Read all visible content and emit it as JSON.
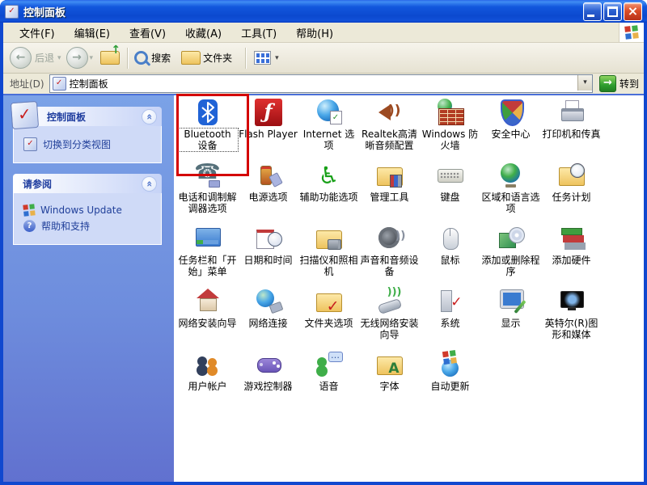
{
  "window": {
    "title": "控制面板"
  },
  "menubar": {
    "items": [
      "文件(F)",
      "编辑(E)",
      "查看(V)",
      "收藏(A)",
      "工具(T)",
      "帮助(H)"
    ]
  },
  "toolbar": {
    "back_label": "后退",
    "search_label": "搜索",
    "folders_label": "文件夹"
  },
  "addressbar": {
    "label": "地址(D)",
    "value": "控制面板",
    "go_label": "转到"
  },
  "sidebar": {
    "panels": [
      {
        "title": "控制面板",
        "items": [
          {
            "label": "切换到分类视图",
            "icon": "switch-category-view-icon"
          }
        ]
      },
      {
        "title": "请参阅",
        "items": [
          {
            "label": "Windows Update",
            "icon": "windows-update-icon"
          },
          {
            "label": "帮助和支持",
            "icon": "help-support-icon"
          }
        ]
      }
    ]
  },
  "grid": {
    "items": [
      {
        "label": "Bluetooth 设备",
        "icon": "bluetooth-devices-icon",
        "highlighted": true,
        "selected": true
      },
      {
        "label": "Flash Player",
        "icon": "flash-player-icon"
      },
      {
        "label": "Internet 选项",
        "icon": "internet-options-icon"
      },
      {
        "label": "Realtek高清晰音频配置",
        "icon": "realtek-audio-icon"
      },
      {
        "label": "Windows 防火墙",
        "icon": "windows-firewall-icon"
      },
      {
        "label": "安全中心",
        "icon": "security-center-icon"
      },
      {
        "label": "打印机和传真",
        "icon": "printers-faxes-icon"
      },
      {
        "label": "电话和调制解调器选项",
        "icon": "phone-modem-options-icon"
      },
      {
        "label": "电源选项",
        "icon": "power-options-icon"
      },
      {
        "label": "辅助功能选项",
        "icon": "accessibility-options-icon"
      },
      {
        "label": "管理工具",
        "icon": "administrative-tools-icon"
      },
      {
        "label": "键盘",
        "icon": "keyboard-icon"
      },
      {
        "label": "区域和语言选项",
        "icon": "regional-language-options-icon"
      },
      {
        "label": "任务计划",
        "icon": "scheduled-tasks-icon"
      },
      {
        "label": "任务栏和「开始」菜单",
        "icon": "taskbar-start-menu-icon"
      },
      {
        "label": "日期和时间",
        "icon": "date-time-icon"
      },
      {
        "label": "扫描仪和照相机",
        "icon": "scanners-cameras-icon"
      },
      {
        "label": "声音和音频设备",
        "icon": "sounds-audio-devices-icon"
      },
      {
        "label": "鼠标",
        "icon": "mouse-icon"
      },
      {
        "label": "添加或删除程序",
        "icon": "add-remove-programs-icon"
      },
      {
        "label": "添加硬件",
        "icon": "add-hardware-icon"
      },
      {
        "label": "网络安装向导",
        "icon": "network-setup-wizard-icon"
      },
      {
        "label": "网络连接",
        "icon": "network-connections-icon"
      },
      {
        "label": "文件夹选项",
        "icon": "folder-options-icon"
      },
      {
        "label": "无线网络安装向导",
        "icon": "wireless-network-setup-wizard-icon"
      },
      {
        "label": "系统",
        "icon": "system-icon"
      },
      {
        "label": "显示",
        "icon": "display-icon"
      },
      {
        "label": "英特尔(R)图形和媒体",
        "icon": "intel-graphics-media-icon"
      },
      {
        "label": "用户帐户",
        "icon": "user-accounts-icon"
      },
      {
        "label": "游戏控制器",
        "icon": "game-controllers-icon"
      },
      {
        "label": "语音",
        "icon": "speech-icon"
      },
      {
        "label": "字体",
        "icon": "fonts-icon"
      },
      {
        "label": "自动更新",
        "icon": "automatic-updates-icon"
      }
    ]
  },
  "colors": {
    "highlight_red": "#d40000",
    "titlebar_blue": "#0b49cf",
    "sidebar_top": "#7ba2e7",
    "sidebar_bottom": "#6171cf",
    "panel_body": "#cfdaf7",
    "link_blue": "#21409a",
    "go_green": "#2f9e2f"
  }
}
